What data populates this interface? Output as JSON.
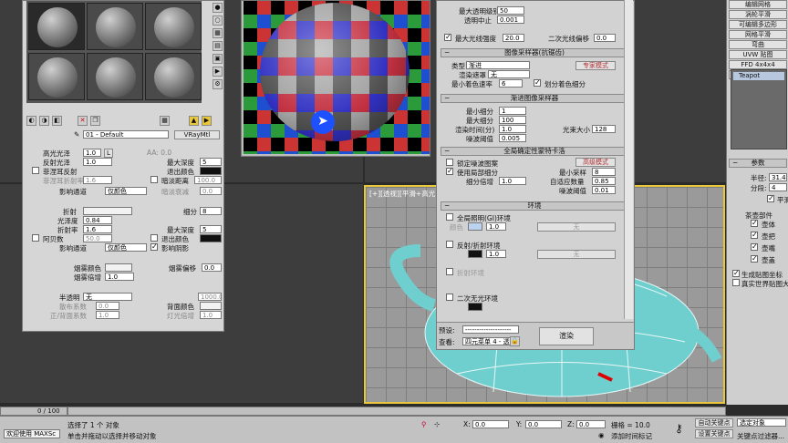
{
  "colors": {
    "accent": "#e8c73a",
    "selection": "#ff8800",
    "teapot": "#77d6d6",
    "panel": "#d6d6d6"
  },
  "material_editor": {
    "name_field": "01 - Default",
    "type_button": "VRayMtl",
    "hilight": {
      "label": "高光光泽",
      "value": "1.0",
      "lock": "L"
    },
    "refl_gloss": {
      "label": "反射光泽",
      "value": "1.0"
    },
    "fresnel": {
      "label": "菲涅耳反射"
    },
    "fresnel_ior": {
      "label": "菲涅耳折射率",
      "value": "1.6"
    },
    "max_depth": {
      "label": "最大深度",
      "value": "5"
    },
    "exit_color": {
      "label": "退出颜色"
    },
    "dim_distance": {
      "label": "暗淡距离",
      "value": "100.0"
    },
    "dim_falloff": {
      "label": "暗淡衰减",
      "value": "0.0"
    },
    "affect_channels": {
      "label": "影响通道",
      "value": "仅颜色"
    },
    "refraction": {
      "label": "折射",
      "subdivs_label": "细分",
      "subdivs": "8"
    },
    "refr_gloss": {
      "label": "光泽度",
      "value": "0.84"
    },
    "refr_ior": {
      "label": "折射率",
      "value": "1.6"
    },
    "refr_max_depth": {
      "label": "最大深度",
      "value": "5"
    },
    "abbe": {
      "label": "阿贝数",
      "value": "50.0"
    },
    "refr_exit": {
      "label": "退出颜色"
    },
    "refr_affect": {
      "label": "影响通道",
      "value": "仅颜色"
    },
    "affect_shadows": {
      "label": "影响阴影"
    },
    "fog_color": {
      "label": "烟雾颜色"
    },
    "fog_mult": {
      "label": "烟雾倍增",
      "value": "1.0"
    },
    "fog_bias": {
      "label": "烟雾偏移",
      "value": "0.0"
    },
    "translucency": {
      "label": "半透明",
      "value": "无"
    },
    "scatter": {
      "label": "散布系数",
      "value": "0.0"
    },
    "fwd_back": {
      "label": "正/背面系数",
      "value": "1.0"
    },
    "thickness": {
      "value": "1000.0"
    },
    "back_color": {
      "label": "背面颜色"
    },
    "light_mult": {
      "label": "灯光倍增",
      "value": "1.0"
    },
    "aa_value": "AA: 0.0"
  },
  "render_dialog": {
    "max_trans_level": {
      "label": "最大透明级别",
      "value": "50"
    },
    "trans_cutoff": {
      "label": "透明中止",
      "value": "0.001"
    },
    "max_ray_intensity": {
      "label": "最大光线强度",
      "value": "20.0"
    },
    "secondary_bias": {
      "label": "二次光线偏移",
      "value": "0.0"
    },
    "image_sampler_title": "图像采样器(抗锯齿)",
    "sampler_type": {
      "label": "类型",
      "value": "渐进"
    },
    "expert_mode": "专家模式",
    "render_mask": {
      "label": "渲染遮罩",
      "value": "无"
    },
    "min_shading": {
      "label": "最小着色速率",
      "value": "6"
    },
    "divide_shading": {
      "label": "划分着色细分"
    },
    "progressive_title": "渐进图像采样器",
    "min_subdiv": {
      "label": "最小细分",
      "value": "1"
    },
    "max_subdiv": {
      "label": "最大细分",
      "value": "100"
    },
    "render_time": {
      "label": "渲染时间(分)",
      "value": "1.0"
    },
    "bundle_size": {
      "label": "光束大小",
      "value": "128"
    },
    "noise_thresh": {
      "label": "噪波阈值",
      "value": "0.005"
    },
    "global_dmc_title": "全局确定性蒙特卡洛",
    "lock_noise": {
      "label": "锁定噪波图案"
    },
    "advanced_mode": "高级模式",
    "use_local_subdiv": {
      "label": "使用局部细分"
    },
    "min_samples": {
      "label": "最小采样",
      "value": "8"
    },
    "subdiv_mult": {
      "label": "细分倍增",
      "value": "1.0"
    },
    "adaptive_amount": {
      "label": "自适应数量",
      "value": "0.85"
    },
    "noise_thresh2": {
      "label": "噪波阈值",
      "value": "0.01"
    },
    "environment_title": "环境",
    "gi_env": {
      "label": "全局照明(GI)环境"
    },
    "gi_mult": {
      "label": "颜色",
      "value": "1.0",
      "map": "无"
    },
    "refl_env": {
      "label": "反射/折射环境"
    },
    "refl_mult": {
      "value": "1.0",
      "map": "无"
    },
    "refr_env": {
      "label": "折射环境"
    },
    "secondary_env": {
      "label": "二次无光环境"
    },
    "preset": {
      "label": "预设:",
      "value": "--------------------"
    },
    "view": {
      "label": "查看:",
      "value": "四元菜单 4 - 透"
    },
    "render_button": "渲染"
  },
  "viewport": {
    "label": "[+][透视][平滑+高光]"
  },
  "right_panel": {
    "buttons": [
      "编辑网格",
      "涡轮平滑",
      "可编辑多边形",
      "网格平滑",
      "弯曲",
      "UVW 贴图",
      "FFD 4x4x4",
      "车削"
    ],
    "object_name": "Teapot",
    "params_title": "参数",
    "radius": {
      "label": "半径:",
      "value": "31.4"
    },
    "segments": {
      "label": "分段:",
      "value": "4"
    },
    "smooth": {
      "label": "平滑"
    },
    "parts_title": "茶壶部件",
    "parts": [
      "壶体",
      "壶把",
      "壶嘴",
      "壶盖"
    ],
    "gen_map": {
      "label": "生成贴图坐标"
    },
    "real_world": {
      "label": "真实世界贴图大小"
    }
  },
  "statusbar": {
    "frame": "0 / 100",
    "selection": "选择了 1 个 对象",
    "prompt": "单击并拖动以选择并移动对象",
    "script_mini": "欢迎使用 MAXSc",
    "x_label": "X:",
    "x_value": "0.0",
    "y_label": "Y:",
    "y_value": "0.0",
    "z_label": "Z:",
    "z_value": "0.0",
    "grid": "栅格 = 10.0",
    "add_time_tag": "添加时间标记",
    "auto_key": "自动关键点",
    "set_key": "设置关键点",
    "selected": "选定对象",
    "key_filters": "关键点过滤器..."
  }
}
